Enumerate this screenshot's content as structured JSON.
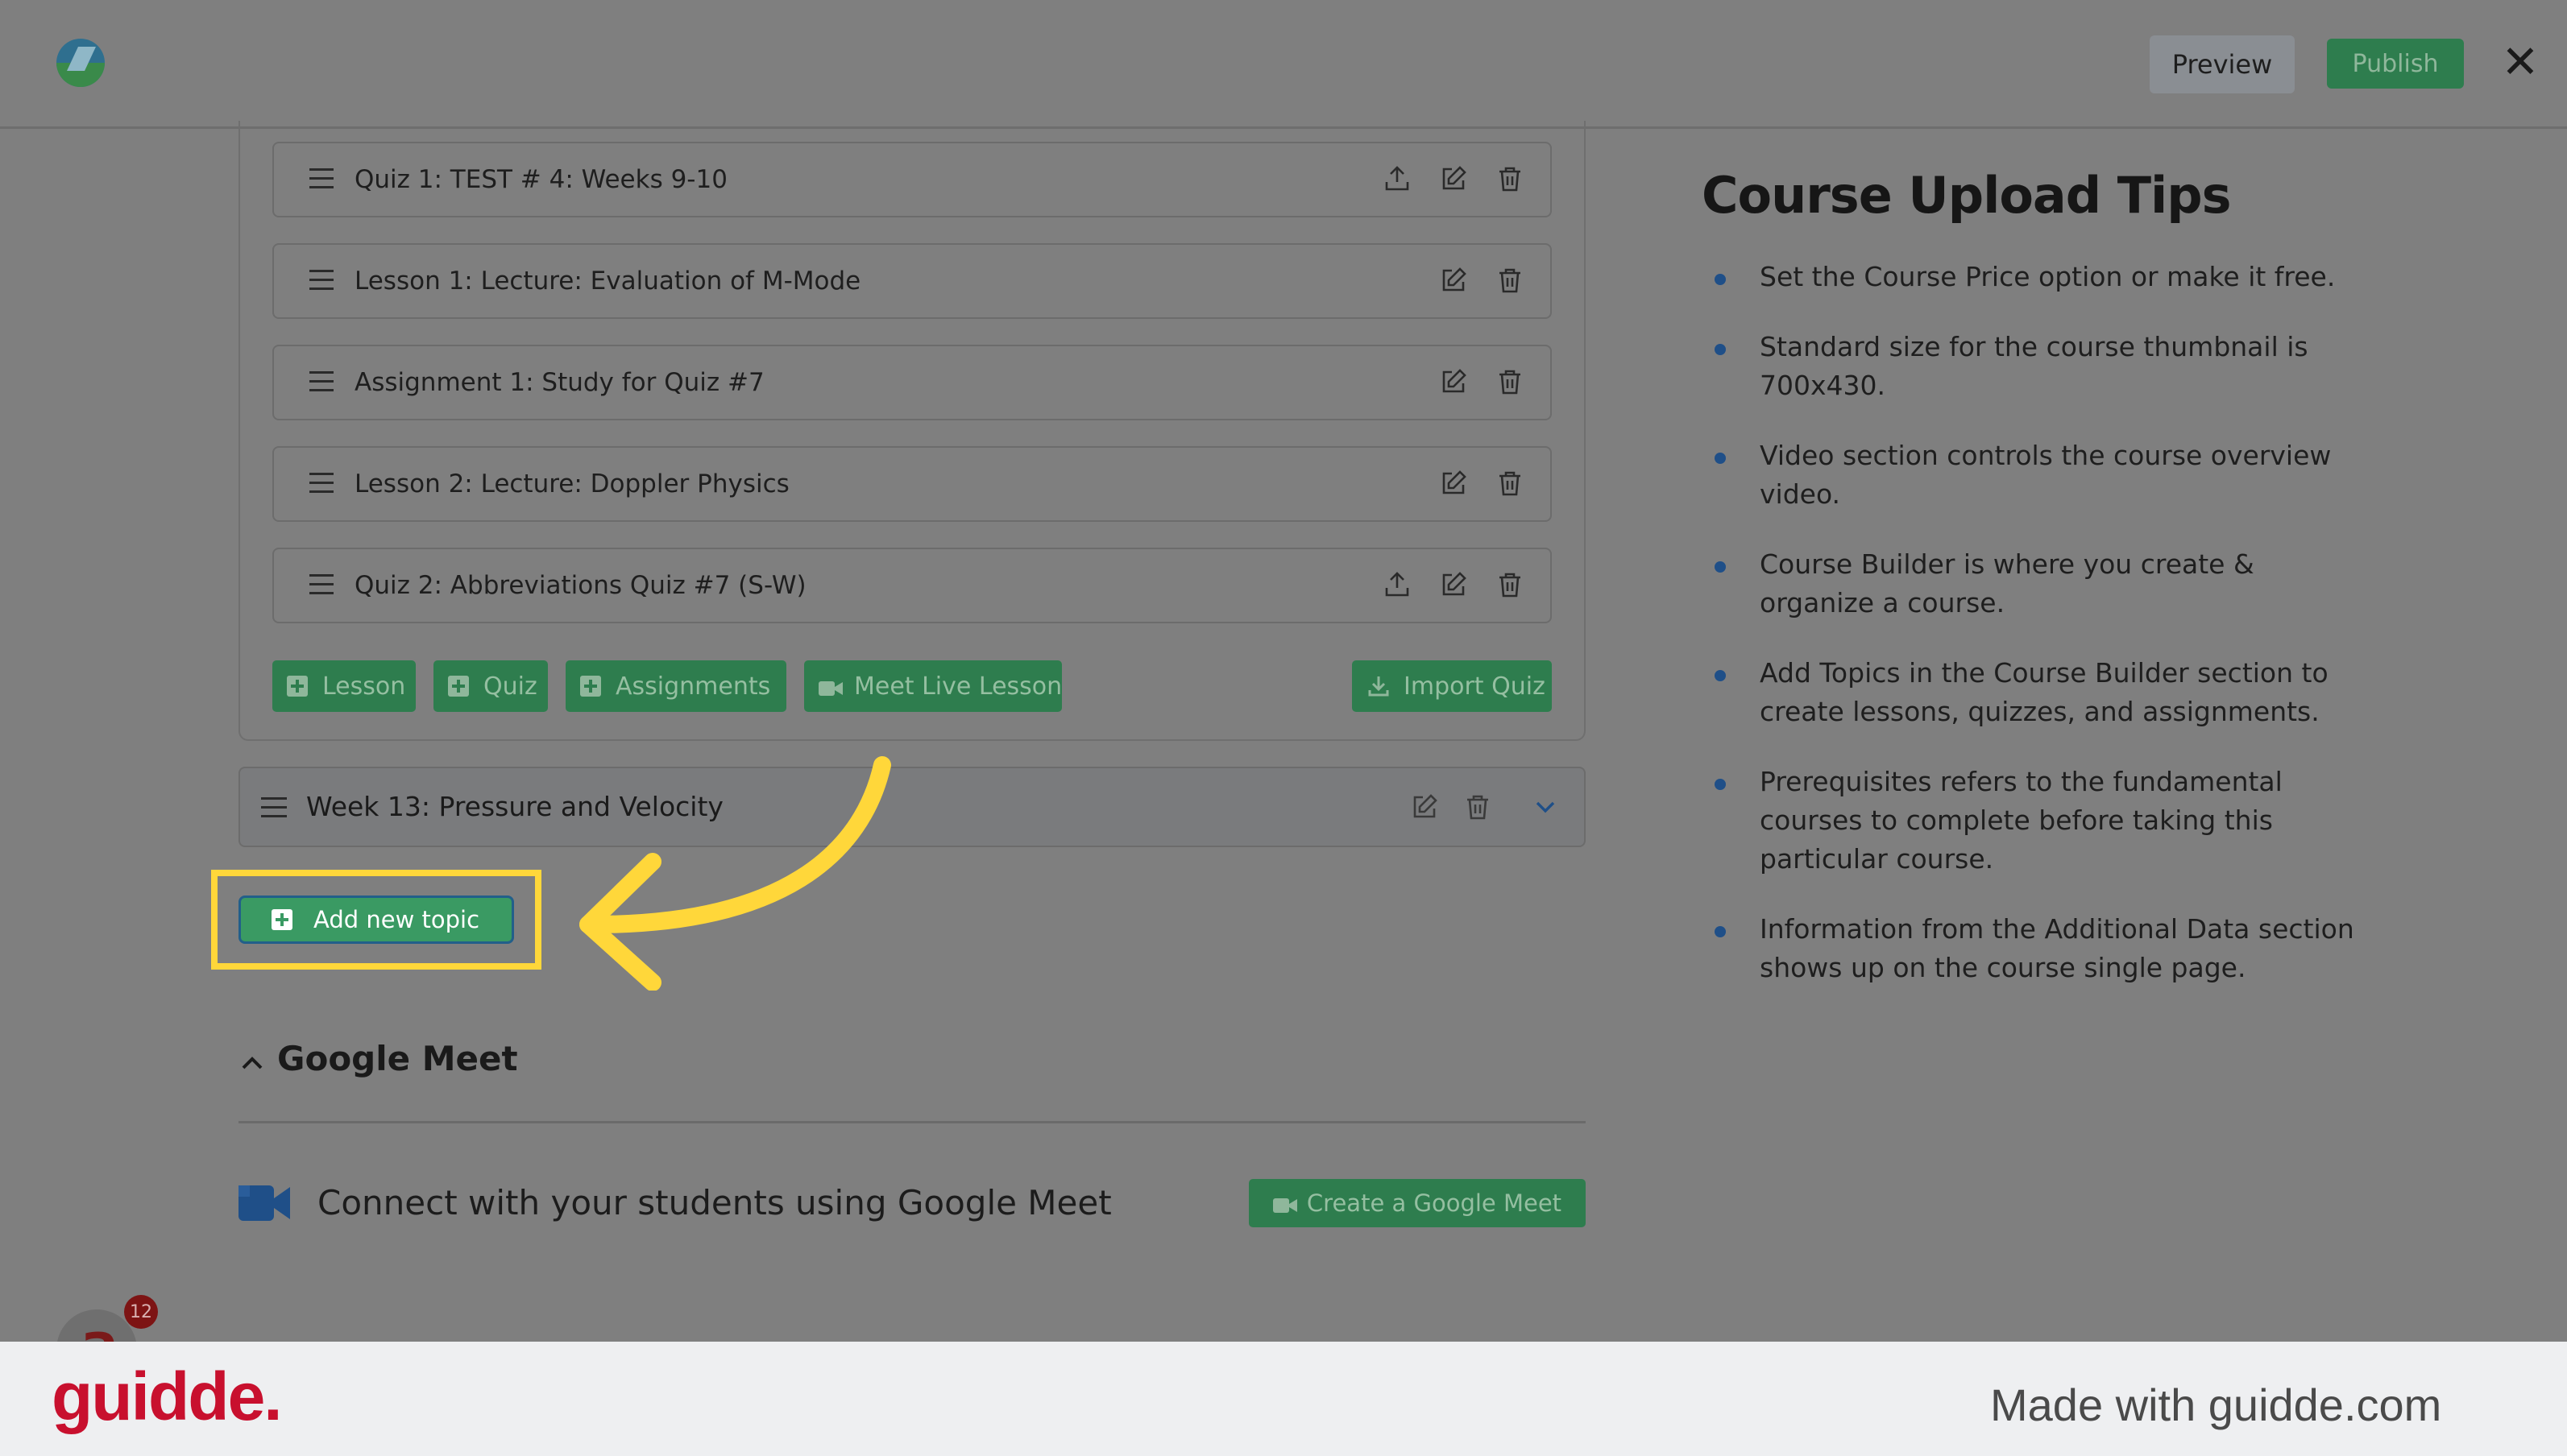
{
  "header": {
    "preview_label": "Preview",
    "publish_label": "Publish",
    "close_glyph": "✕",
    "logo_icon": "app-logo-icon"
  },
  "topic_items": [
    {
      "label": "Quiz 1: TEST # 4: Weeks 9-10",
      "has_upload": true
    },
    {
      "label": "Lesson 1: Lecture: Evaluation of M-Mode",
      "has_upload": false
    },
    {
      "label": "Assignment 1: Study for Quiz #7",
      "has_upload": false
    },
    {
      "label": "Lesson 2: Lecture: Doppler Physics",
      "has_upload": false
    },
    {
      "label": "Quiz 2: Abbreviations Quiz #7 (S-W)",
      "has_upload": true
    }
  ],
  "content_buttons": {
    "lesson": "Lesson",
    "quiz": "Quiz",
    "assignments": "Assignments",
    "meet_live": "Meet Live Lesson",
    "import_quiz": "Import Quiz"
  },
  "week": {
    "title": "Week 13: Pressure and Velocity"
  },
  "add_topic_label": "Add new topic",
  "google_meet": {
    "heading": "Google Meet",
    "connect_text": "Connect with your students using Google Meet",
    "create_button": "Create a Google Meet"
  },
  "tips": {
    "title": "Course Upload Tips",
    "items": [
      "Set the Course Price option or make it free.",
      "Standard size for the course thumbnail is 700x430.",
      "Video section controls the course overview video.",
      "Course Builder is where you create & organize a course.",
      "Add Topics in the Course Builder section to create lessons, quizzes, and assignments.",
      "Prerequisites refers to the fundamental courses to complete before taking this particular course.",
      "Information from the Additional Data section shows up on the course single page."
    ]
  },
  "notification_badge": "12",
  "footer": {
    "brand": "guidde.",
    "made_with": "Made with guidde.com"
  },
  "colors": {
    "accent_green": "#2e7d4e",
    "highlight_yellow": "#ffd73a",
    "brand_red": "#c8102e"
  }
}
